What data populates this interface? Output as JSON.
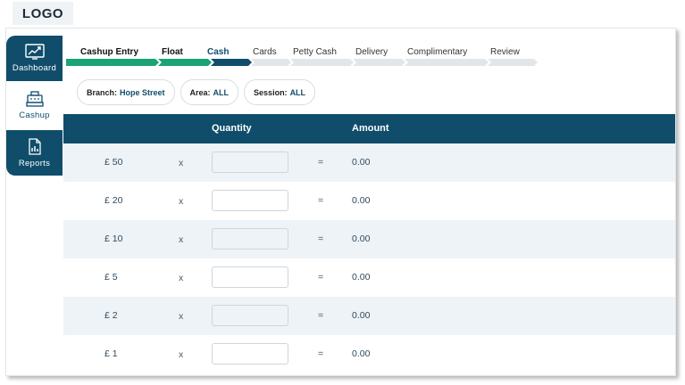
{
  "logo": "LOGO",
  "sidebar": {
    "items": [
      {
        "label": "Dashboard",
        "icon": "dashboard-chart-icon"
      },
      {
        "label": "Cashup",
        "icon": "cash-register-icon"
      },
      {
        "label": "Reports",
        "icon": "report-document-icon"
      }
    ]
  },
  "steps": [
    {
      "label": "Cashup Entry",
      "state": "done"
    },
    {
      "label": "Float",
      "state": "done"
    },
    {
      "label": "Cash",
      "state": "current"
    },
    {
      "label": "Cards",
      "state": "pending"
    },
    {
      "label": "Petty Cash",
      "state": "pending"
    },
    {
      "label": "Delivery",
      "state": "pending"
    },
    {
      "label": "Complimentary",
      "state": "pending"
    },
    {
      "label": "Review",
      "state": "pending"
    }
  ],
  "filters": {
    "branch_label": "Branch:",
    "branch_value": "Hope Street",
    "area_label": "Area:",
    "area_value": "ALL",
    "session_label": "Session:",
    "session_value": "ALL"
  },
  "table": {
    "headers": {
      "quantity": "Quantity",
      "amount": "Amount"
    },
    "rows": [
      {
        "denomination": "£ 50",
        "times": "x",
        "quantity": "",
        "equals": "=",
        "amount": "0.00"
      },
      {
        "denomination": "£ 20",
        "times": "x",
        "quantity": "",
        "equals": "=",
        "amount": "0.00"
      },
      {
        "denomination": "£ 10",
        "times": "x",
        "quantity": "",
        "equals": "=",
        "amount": "0.00"
      },
      {
        "denomination": "£ 5",
        "times": "x",
        "quantity": "",
        "equals": "=",
        "amount": "0.00"
      },
      {
        "denomination": "£ 2",
        "times": "x",
        "quantity": "",
        "equals": "=",
        "amount": "0.00"
      },
      {
        "denomination": "£ 1",
        "times": "x",
        "quantity": "",
        "equals": "=",
        "amount": "0.00"
      }
    ]
  },
  "colors": {
    "primary": "#0f4d6b",
    "done": "#1aa377",
    "pending": "#e3e6e8",
    "row_alt": "#eef3f7"
  }
}
